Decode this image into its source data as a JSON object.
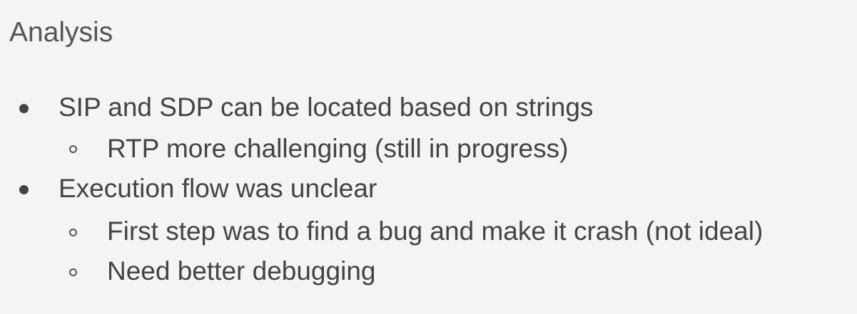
{
  "slide": {
    "title": "Analysis",
    "bullets": [
      {
        "text": "SIP and SDP can be located based on strings",
        "children": [
          {
            "text": "RTP more challenging (still in progress)"
          }
        ]
      },
      {
        "text": "Execution flow was unclear",
        "children": [
          {
            "text": "First step was to find a bug and make it crash (not ideal)"
          },
          {
            "text": "Need better debugging"
          }
        ]
      }
    ]
  }
}
